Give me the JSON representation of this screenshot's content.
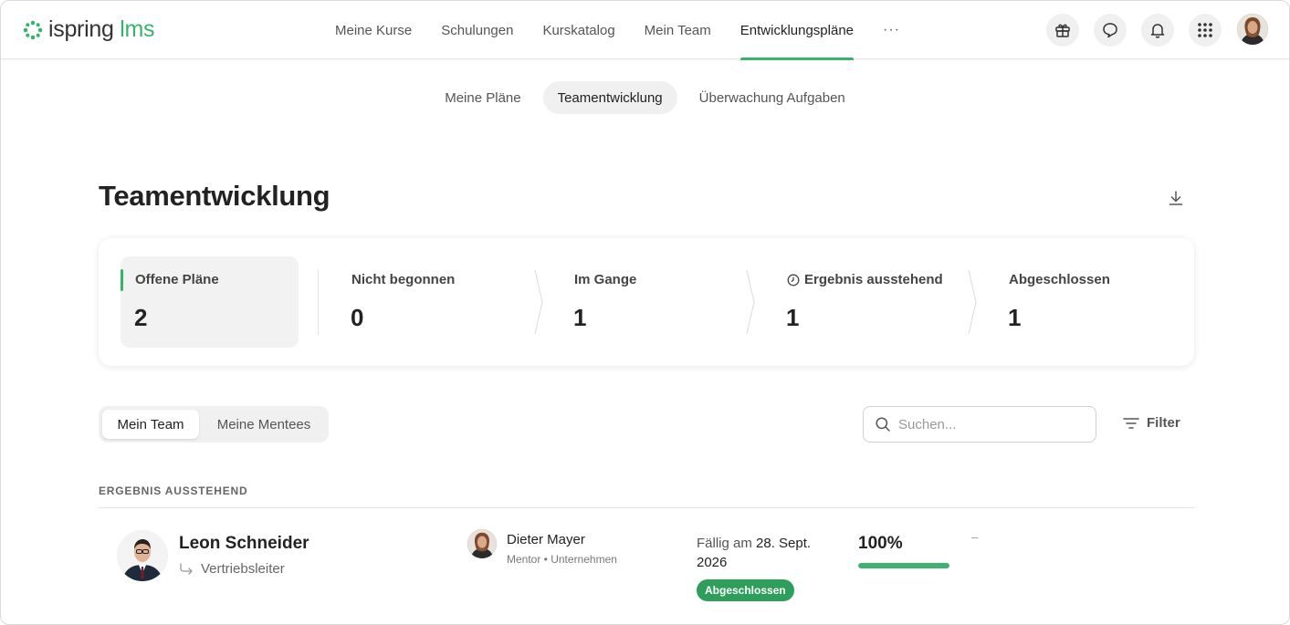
{
  "app": {
    "logo_main": "ispring",
    "logo_accent": "lms"
  },
  "nav": {
    "items": [
      {
        "label": "Meine Kurse"
      },
      {
        "label": "Schulungen"
      },
      {
        "label": "Kurskatalog"
      },
      {
        "label": "Mein Team"
      },
      {
        "label": "Entwicklungspläne"
      }
    ],
    "more": "···",
    "icons": [
      "gift-icon",
      "chat-icon",
      "bell-icon",
      "apps-grid-icon",
      "user-avatar"
    ]
  },
  "subtabs": [
    {
      "label": "Meine Pläne"
    },
    {
      "label": "Teamentwicklung"
    },
    {
      "label": "Überwachung Aufgaben"
    }
  ],
  "page": {
    "title": "Teamentwicklung"
  },
  "stats": [
    {
      "label": "Offene Pläne",
      "value": "2"
    },
    {
      "label": "Nicht begonnen",
      "value": "0"
    },
    {
      "label": "Im Gange",
      "value": "1"
    },
    {
      "label": "Ergebnis ausstehend",
      "value": "1"
    },
    {
      "label": "Abgeschlossen",
      "value": "1"
    }
  ],
  "segment": {
    "options": [
      "Mein Team",
      "Meine Mentees"
    ],
    "selected": "Mein Team"
  },
  "search": {
    "placeholder": "Suchen...",
    "value": ""
  },
  "filter": {
    "label": "Filter"
  },
  "section": {
    "label": "ERGEBNIS AUSSTEHEND"
  },
  "rows": [
    {
      "name": "Leon Schneider",
      "role": "Vertriebsleiter",
      "mentor_name": "Dieter Mayer",
      "mentor_sub": "Mentor • Unternehmen",
      "due_prefix": "Fällig am",
      "due_date": "28. Sept.",
      "due_year": "2026",
      "status": "Abgeschlossen",
      "progress_label": "100%",
      "progress": 1.0,
      "extra": "–"
    }
  ],
  "colors": {
    "accent": "#37b36c",
    "badge": "#2e9e5b"
  }
}
